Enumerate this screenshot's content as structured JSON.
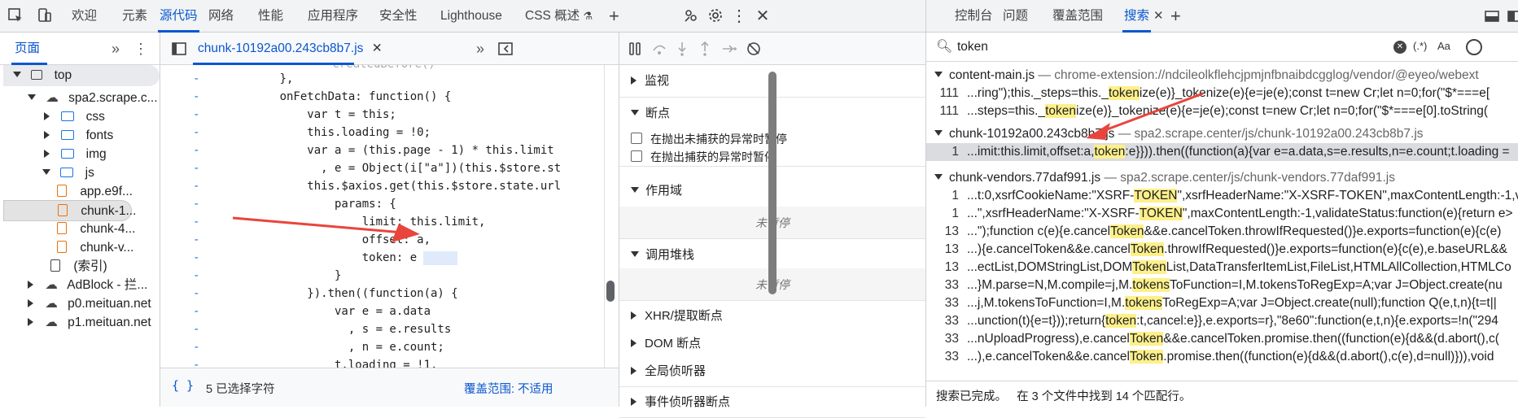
{
  "toolbar": {
    "tabs": [
      "欢迎",
      "元素",
      "源代码",
      "网络",
      "性能",
      "应用程序",
      "安全性",
      "Lighthouse",
      "CSS 概述"
    ],
    "selected_tab": "源代码"
  },
  "right_toolbar": {
    "tabs": [
      "控制台",
      "问题",
      "覆盖范围",
      "搜索"
    ],
    "selected_tab": "搜索"
  },
  "navigator": {
    "tab_label": "页面",
    "tree": [
      {
        "label": "top",
        "depth": 0,
        "type": "frame",
        "expanded": true
      },
      {
        "label": "spa2.scrape.c...",
        "depth": 1,
        "type": "cloud",
        "expanded": true
      },
      {
        "label": "css",
        "depth": 2,
        "type": "folder",
        "expanded": false
      },
      {
        "label": "fonts",
        "depth": 2,
        "type": "folder",
        "expanded": false
      },
      {
        "label": "img",
        "depth": 2,
        "type": "folder",
        "expanded": false
      },
      {
        "label": "js",
        "depth": 2,
        "type": "folder",
        "expanded": true
      },
      {
        "label": "app.e9f...",
        "depth": 3,
        "type": "file"
      },
      {
        "label": "chunk-1...",
        "depth": 3,
        "type": "file",
        "selected": true
      },
      {
        "label": "chunk-4...",
        "depth": 3,
        "type": "file"
      },
      {
        "label": "chunk-v...",
        "depth": 3,
        "type": "file"
      },
      {
        "label": "(索引)",
        "depth": 2,
        "type": "doc"
      },
      {
        "label": "AdBlock - 拦...",
        "depth": 1,
        "type": "cloud",
        "expanded": false
      },
      {
        "label": "p0.meituan.net",
        "depth": 1,
        "type": "cloud",
        "expanded": false
      },
      {
        "label": "p1.meituan.net",
        "depth": 1,
        "type": "cloud",
        "expanded": false
      }
    ]
  },
  "editor": {
    "file_tab": "chunk-10192a00.243cb8b7.js",
    "code_lines": [
      "        createdBefore()",
      "      },",
      "      onFetchData: function() {",
      "          var t = this;",
      "          this.loading = !0;",
      "          var a = (this.page - 1) * this.limit",
      "            , e = Object(i[\"a\"])(this.$store.st",
      "          this.$axios.get(this.$store.state.url",
      "              params: {",
      "                  limit: this.limit,",
      "                  offset: a,",
      "                  token: e",
      "              }",
      "          }).then((function(a) {",
      "              var e = a.data",
      "                , s = e.results",
      "                , n = e.count;",
      "              t.loading = !1,"
    ],
    "status_left": "5 已选择字符",
    "status_right": "覆盖范围: 不适用"
  },
  "debugger": {
    "watch": "监视",
    "breakpoints": "断点",
    "pause_uncaught": "在抛出未捕获的异常时暂停",
    "pause_caught": "在抛出捕获的异常时暂停",
    "scope": "作用域",
    "not_paused": "未暂停",
    "callstack": "调用堆栈",
    "xhr": "XHR/提取断点",
    "dom": "DOM 断点",
    "global": "全局侦听器",
    "event": "事件侦听器断点"
  },
  "search": {
    "query": "token",
    "regex_label": "(.*)",
    "case_label": "Aa",
    "groups": [
      {
        "file": "content-main.js",
        "path": "— chrome-extension://ndcileolkflehcjpmjnfbnaibdcgglog/vendor/@eyeo/webext",
        "lines": [
          {
            "n": "111",
            "pre": "...ring\");this._steps=this._",
            "hit": "token",
            "post": "ize(e)}_tokenize(e){e=je(e);const t=new Cr;let n=0;for(\"$*===e["
          },
          {
            "n": "111",
            "pre": "...steps=this._",
            "hit": "token",
            "post": "ize(e)}_tokenize(e){e=je(e);const t=new Cr;let n=0;for(\"$*===e[0].toString("
          }
        ]
      },
      {
        "file": "chunk-10192a00.243cb8b7.js",
        "path": "— spa2.scrape.center/js/chunk-10192a00.243cb8b7.js",
        "lines": [
          {
            "n": "1",
            "pre": "...imit:this.limit,offset:a,",
            "hit": "token",
            "post": ":e}})).then((function(a){var e=a.data,s=e.results,n=e.count;t.loading =",
            "selected": true
          }
        ]
      },
      {
        "file": "chunk-vendors.77daf991.js",
        "path": "— spa2.scrape.center/js/chunk-vendors.77daf991.js",
        "lines": [
          {
            "n": "1",
            "pre": "...t:0,xsrfCookieName:\"XSRF-",
            "hit": "TOKEN",
            "post": "\",xsrfHeaderName:\"X-XSRF-TOKEN\",maxContentLength:-1,va"
          },
          {
            "n": "1",
            "pre": "...\",xsrfHeaderName:\"X-XSRF-",
            "hit": "TOKEN",
            "post": "\",maxContentLength:-1,validateStatus:function(e){return e>"
          },
          {
            "n": "13",
            "pre": "...\");function c(e){e.cancel",
            "hit": "Token",
            "post": "&&e.cancelToken.throwIfRequested()}e.exports=function(e){c(e)"
          },
          {
            "n": "13",
            "pre": "...){e.cancelToken&&e.cancel",
            "hit": "Token",
            "post": ".throwIfRequested()}e.exports=function(e){c(e),e.baseURL&&"
          },
          {
            "n": "13",
            "pre": "...ectList,DOMStringList,DOM",
            "hit": "Token",
            "post": "List,DataTransferItemList,FileList,HTMLAllCollection,HTMLCo"
          },
          {
            "n": "33",
            "pre": "...}M.parse=N,M.compile=j,M.",
            "hit": "tokens",
            "post": "ToFunction=I,M.tokensToRegExp=A;var J=Object.create(nu"
          },
          {
            "n": "33",
            "pre": "...j,M.tokensToFunction=I,M.",
            "hit": "tokens",
            "post": "ToRegExp=A;var J=Object.create(null);function Q(e,t,n){t=t||"
          },
          {
            "n": "33",
            "pre": "...unction(t){e=t}));return{",
            "hit": "token",
            "post": ":t,cancel:e}},e.exports=r},\"8e60\":function(e,t,n){e.exports=!n(\"294"
          },
          {
            "n": "33",
            "pre": "...nUploadProgress),e.cancel",
            "hit": "Token",
            "post": "&&e.cancelToken.promise.then((function(e){d&&(d.abort(),c("
          },
          {
            "n": "33",
            "pre": "...),e.cancelToken&&e.cancel",
            "hit": "Token",
            "post": ".promise.then((function(e){d&&(d.abort(),c(e),d=null)})),void"
          }
        ]
      }
    ],
    "status": "搜索已完成。   在 3 个文件中找到 14 个匹配行。"
  },
  "colors": {
    "accent": "#0b57d0",
    "highlight": "#fdf08b",
    "arrow": "#e8453c"
  }
}
